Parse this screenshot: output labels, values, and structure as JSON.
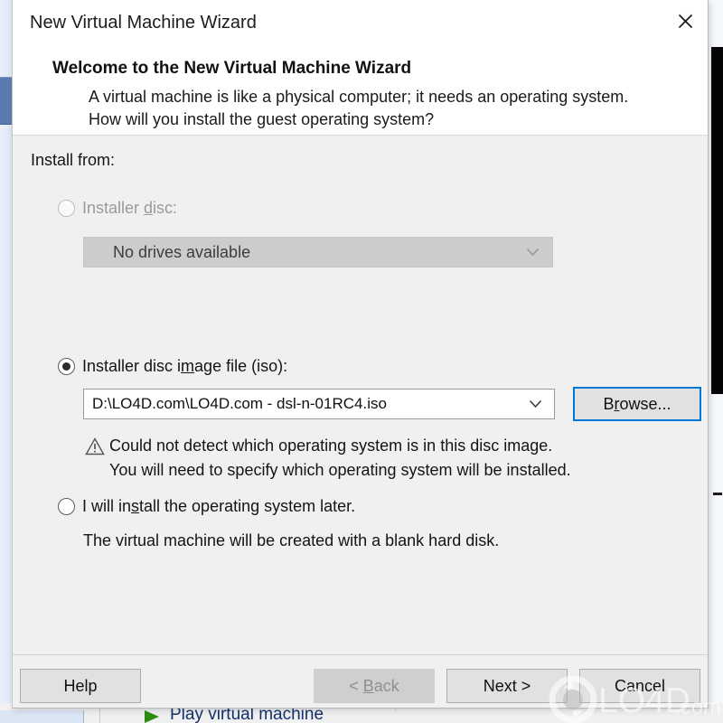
{
  "dialog": {
    "title": "New Virtual Machine Wizard",
    "close_icon": "close-icon",
    "header": {
      "heading": "Welcome to the New Virtual Machine Wizard",
      "paragraph": "A virtual machine is like a physical computer; it needs an operating system. How will you install the guest operating system?"
    },
    "body": {
      "install_from_label": "Install from:",
      "option_disc": {
        "label_prefix": "Installer ",
        "label_accel": "d",
        "label_suffix": "isc:",
        "selected": false,
        "enabled": false,
        "drive_combo": {
          "value": "No drives available",
          "enabled": false,
          "chevron_icon": "chevron-down-icon"
        }
      },
      "option_iso": {
        "label_prefix": "Installer disc i",
        "label_accel": "m",
        "label_suffix": "age file (iso):",
        "selected": true,
        "enabled": true,
        "path_combo": {
          "value": "D:\\LO4D.com\\LO4D.com - dsl-n-01RC4.iso",
          "placeholder": "",
          "chevron_icon": "chevron-down-icon"
        },
        "browse_button": {
          "prefix": "B",
          "accel": "r",
          "suffix": "owse...",
          "focus_color": "#0078d7"
        },
        "warning": {
          "icon": "warning-triangle-icon",
          "line1": "Could not detect which operating system is in this disc image.",
          "line2": "You will need to specify which operating system will be installed."
        }
      },
      "option_later": {
        "label_prefix": "I will in",
        "label_accel": "s",
        "label_suffix": "tall the operating system later.",
        "selected": false,
        "enabled": true,
        "note": "The virtual machine will be created with a blank hard disk."
      }
    },
    "footer": {
      "help": {
        "label": "Help",
        "enabled": true
      },
      "back": {
        "prefix": "< ",
        "accel": "B",
        "suffix": "ack",
        "enabled": false
      },
      "next": {
        "label": "Next >",
        "enabled": true
      },
      "cancel": {
        "label": "Cancel",
        "enabled": true
      }
    }
  },
  "background": {
    "play_virtual_machine": "Play virtual machine",
    "play_icon": "play-triangle-icon",
    "selection_color": "#5b7ab0"
  },
  "watermark": {
    "text_main": "LO4D",
    "text_suffix": ".com",
    "logo_icon": "lo4d-circular-arrows-logo"
  }
}
